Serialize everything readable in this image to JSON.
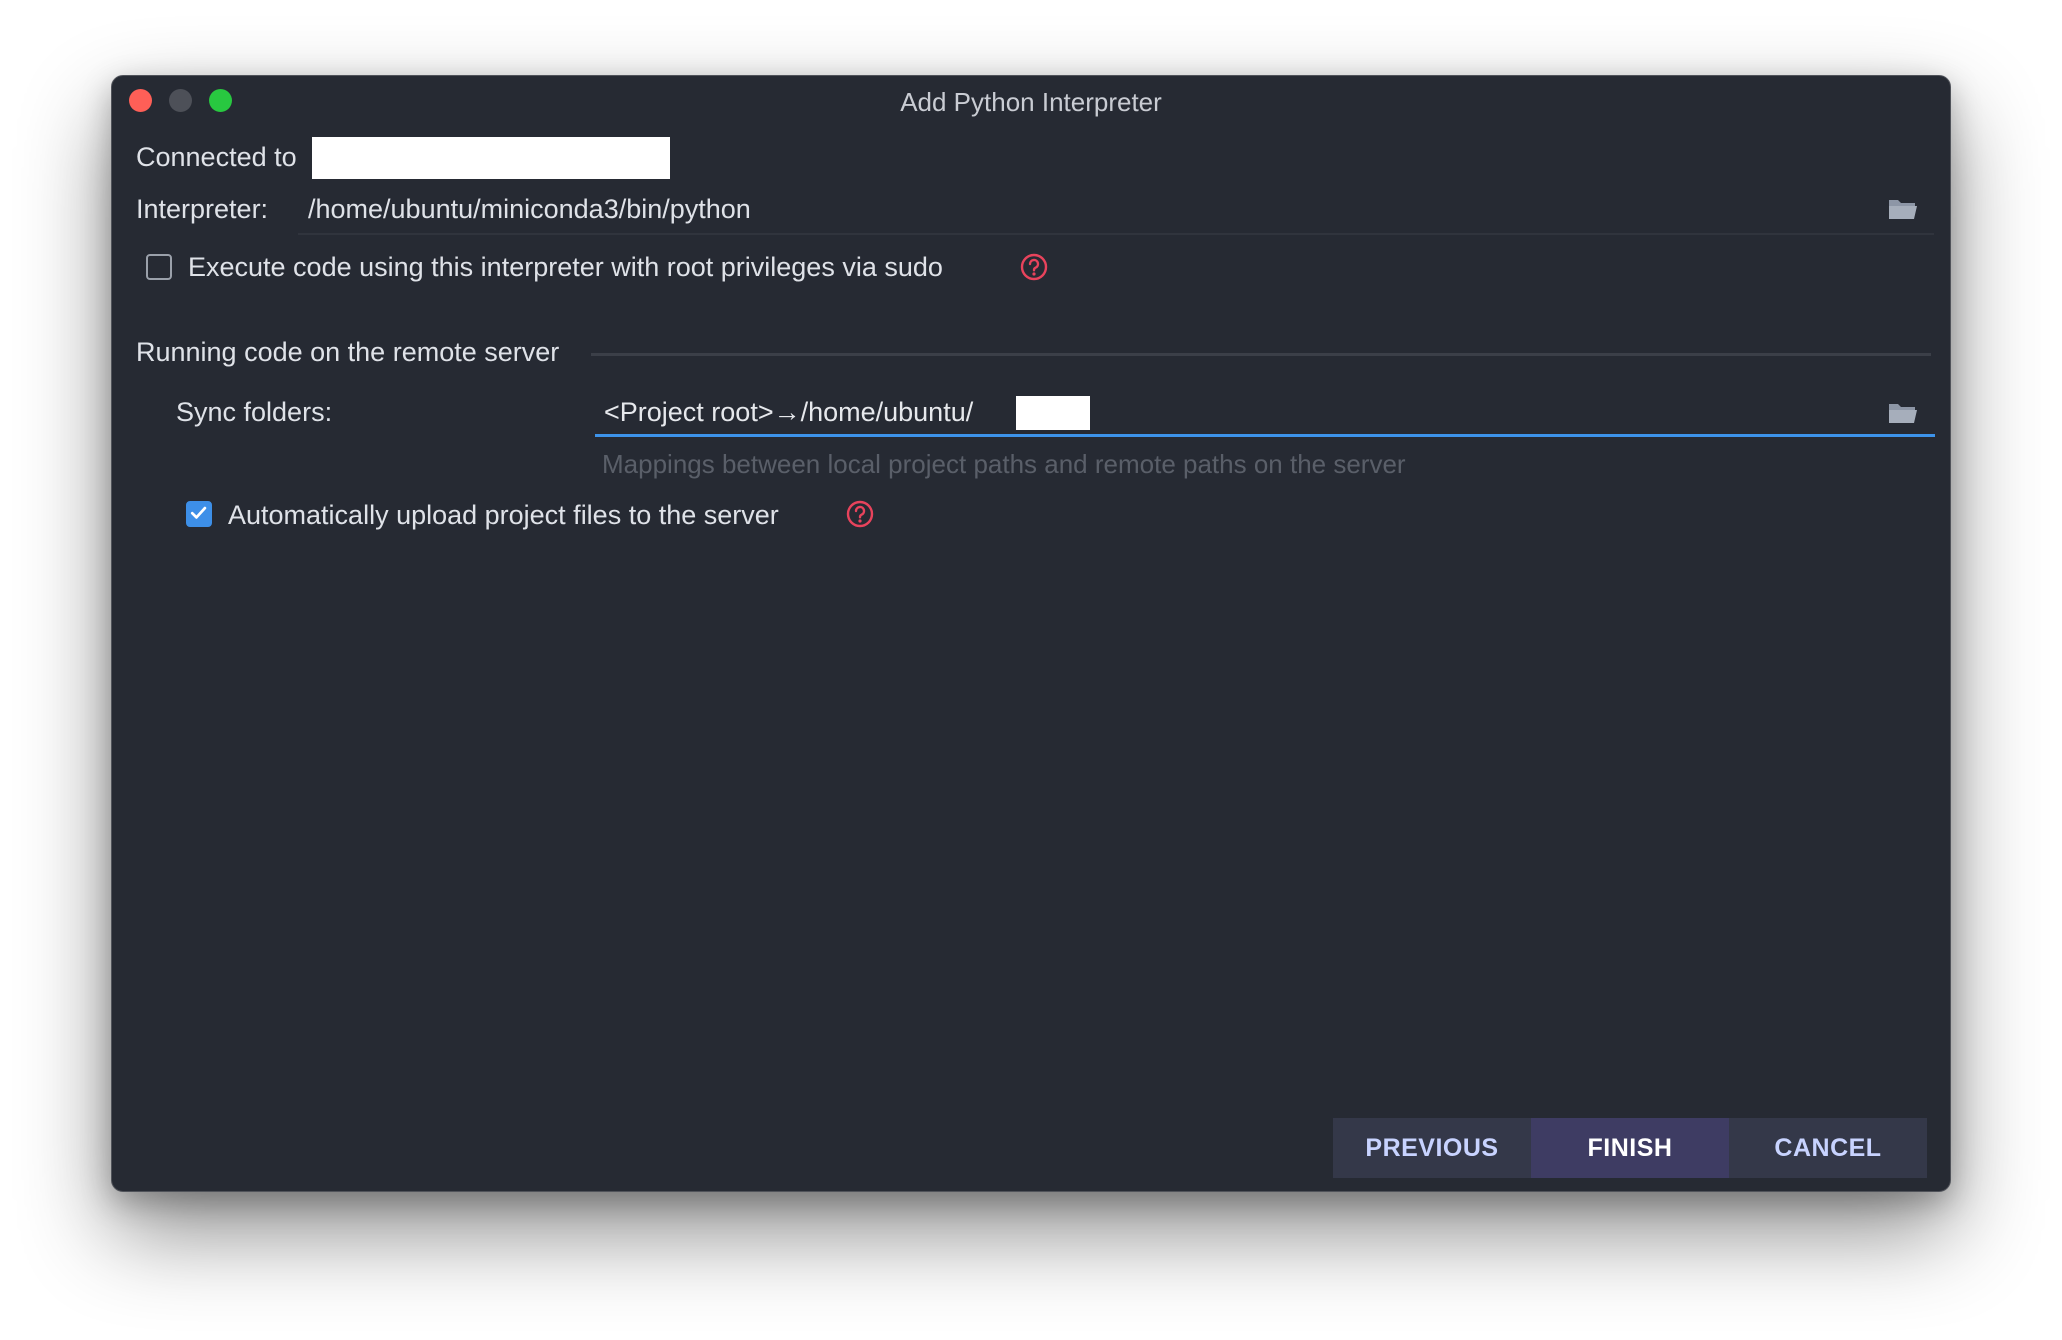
{
  "window": {
    "title": "Add Python Interpreter"
  },
  "connection": {
    "label": "Connected to"
  },
  "interpreter": {
    "label": "Interpreter:",
    "value": "/home/ubuntu/miniconda3/bin/python",
    "browse_icon": "folder-open-icon"
  },
  "sudo": {
    "label": "Execute code using this interpreter with root privileges via sudo",
    "checked": false,
    "help_icon": "question-circle-icon"
  },
  "remote": {
    "section_title": "Running code on the remote server",
    "sync_label": "Sync folders:",
    "sync_value": "<Project root>→/home/ubuntu/",
    "sync_hint": "Mappings between local project paths and remote paths on the server",
    "auto_upload_label": "Automatically upload project files to the server",
    "auto_upload_checked": true
  },
  "buttons": {
    "previous": "PREVIOUS",
    "finish": "FINISH",
    "cancel": "CANCEL"
  },
  "colors": {
    "background": "#262a33",
    "accent": "#3d93ea",
    "help": "#e8435c",
    "button": "#343849",
    "button_active": "#3e3c63"
  }
}
